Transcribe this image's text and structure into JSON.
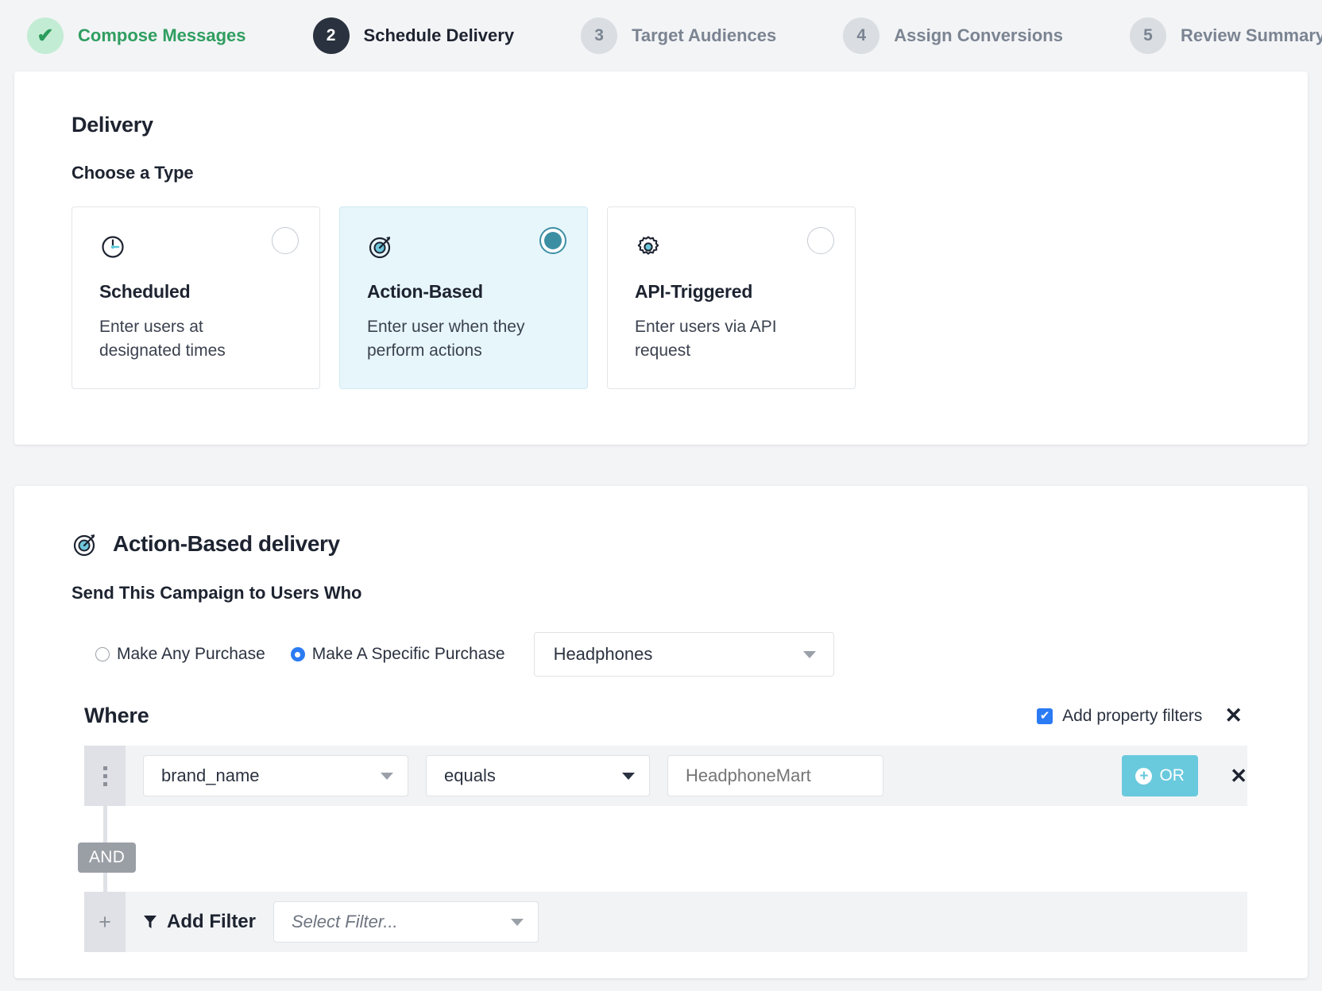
{
  "stepper": [
    {
      "badge": "✔",
      "label": "Compose Messages",
      "state": "done"
    },
    {
      "badge": "2",
      "label": "Schedule Delivery",
      "state": "active"
    },
    {
      "badge": "3",
      "label": "Target Audiences",
      "state": "todo"
    },
    {
      "badge": "4",
      "label": "Assign Conversions",
      "state": "todo"
    },
    {
      "badge": "5",
      "label": "Review Summary",
      "state": "todo"
    }
  ],
  "delivery": {
    "title": "Delivery",
    "choose_type": "Choose a Type",
    "cards": [
      {
        "icon": "clock-icon",
        "name": "Scheduled",
        "desc": "Enter users at designated times",
        "selected": false
      },
      {
        "icon": "target-icon",
        "name": "Action-Based",
        "desc": "Enter user when they perform actions",
        "selected": true
      },
      {
        "icon": "gear-icon",
        "name": "API-Triggered",
        "desc": "Enter users via API request",
        "selected": false
      }
    ]
  },
  "action_based": {
    "heading": "Action-Based delivery",
    "send_title": "Send This Campaign to Users Who",
    "radios": [
      {
        "label": "Make Any Purchase",
        "checked": false
      },
      {
        "label": "Make A Specific Purchase",
        "checked": true
      }
    ],
    "product_select": {
      "value": "Headphones"
    },
    "where_label": "Where",
    "property_filters": {
      "label": "Add property filters",
      "checked": true,
      "check_glyph": "✔"
    },
    "close_glyph": "✕",
    "filter_row": {
      "attribute": "brand_name",
      "operator": "equals",
      "value_placeholder": "HeadphoneMart",
      "or_label": "OR",
      "or_plus": "+",
      "remove_glyph": "✕"
    },
    "connector_label": "AND",
    "add_filter": {
      "plus": "+",
      "label": "Add Filter",
      "select_placeholder": "Select Filter..."
    }
  },
  "colors": {
    "accent_teal": "#3c8fa3",
    "or_button": "#69c9dd",
    "radio_blue": "#2a7bf4",
    "step_done_green": "#2f9e60",
    "step_active_dark": "#29323e"
  }
}
